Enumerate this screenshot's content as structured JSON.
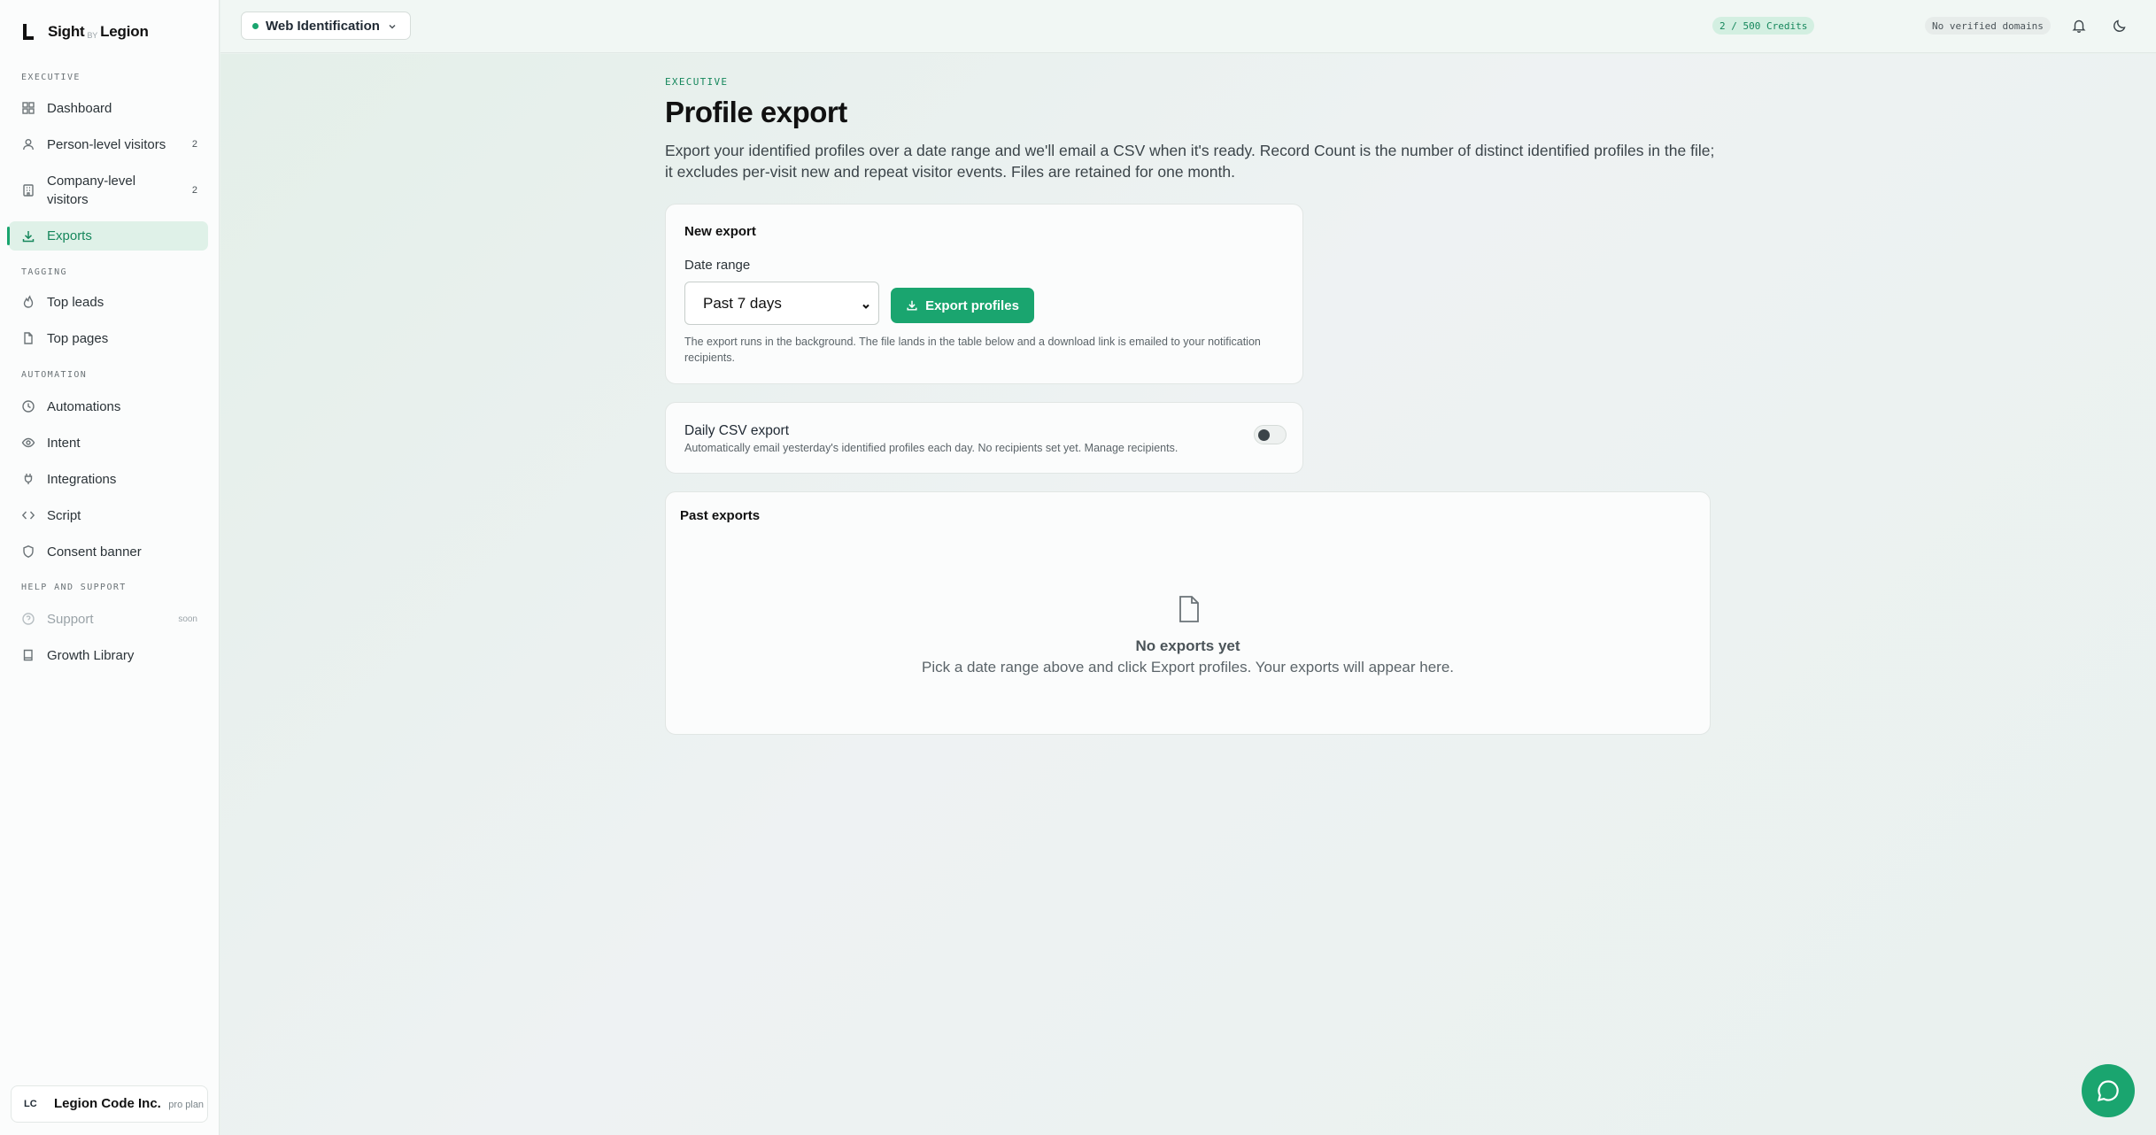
{
  "brand": {
    "name": "Sight",
    "by": "BY",
    "company": "Legion"
  },
  "sidebar": {
    "sections": {
      "executive": "EXECUTIVE",
      "tagging": "TAGGING",
      "automation": "AUTOMATION",
      "help": "HELP AND SUPPORT"
    },
    "items": [
      {
        "label": "Dashboard",
        "icon": "grid-icon"
      },
      {
        "label": "Person-level visitors",
        "icon": "user-icon",
        "count": "2"
      },
      {
        "label": "Company-level visitors",
        "label_line1": "Company-level",
        "label_line2": "visitors",
        "icon": "building-icon",
        "count": "2"
      },
      {
        "label": "Exports",
        "icon": "download-icon",
        "active": true
      },
      {
        "label": "Top leads",
        "icon": "flame-icon"
      },
      {
        "label": "Top pages",
        "icon": "file-icon"
      },
      {
        "label": "Automations",
        "icon": "clock-icon"
      },
      {
        "label": "Intent",
        "icon": "eye-icon"
      },
      {
        "label": "Integrations",
        "icon": "plug-icon"
      },
      {
        "label": "Script",
        "icon": "code-icon"
      },
      {
        "label": "Consent banner",
        "icon": "shield-icon"
      },
      {
        "label": "Support",
        "icon": "help-circle-icon",
        "badge": "soon",
        "disabled": true
      },
      {
        "label": "Growth Library",
        "icon": "book-icon"
      }
    ],
    "account": {
      "initials": "LC",
      "name": "Legion Code Inc.",
      "plan": "pro plan"
    }
  },
  "topbar": {
    "workspace": "Web Identification",
    "credits": "2 / 500 Credits",
    "domains": "No verified domains"
  },
  "page": {
    "eyebrow": "EXECUTIVE",
    "title": "Profile export",
    "description": "Export your identified profiles over a date range and we'll email a CSV when it's ready. Record Count is the number of distinct identified profiles in the file; it excludes per-visit new and repeat visitor events. Files are retained for one month."
  },
  "new_export": {
    "title": "New export",
    "date_range_label": "Date range",
    "date_range_value": "Past 7 days",
    "button_label": "Export profiles",
    "help": "The export runs in the background. The file lands in the table below and a download link is emailed to your notification recipients."
  },
  "daily": {
    "title": "Daily CSV export",
    "subtitle": "Automatically email yesterday's identified profiles each day. No recipients set yet. Manage recipients.",
    "enabled": false
  },
  "past_exports": {
    "title": "Past exports",
    "empty_title": "No exports yet",
    "empty_subtitle": "Pick a date range above and click Export profiles. Your exports will appear here."
  },
  "colors": {
    "accent": "#1aa56f",
    "accent_dark": "#16875c",
    "active_bg": "#dff1e8"
  }
}
